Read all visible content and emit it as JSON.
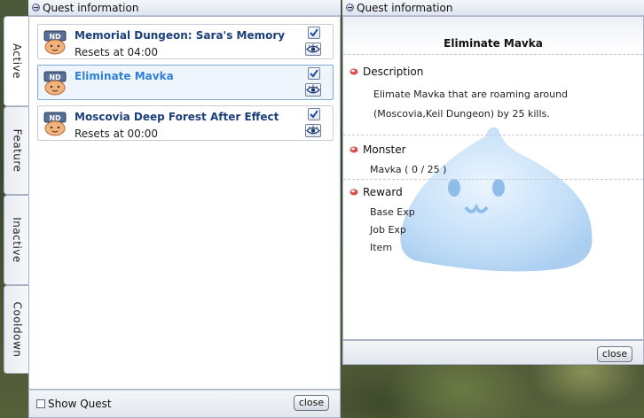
{
  "left_window": {
    "title": "Quest information",
    "tabs": [
      {
        "label": "Active",
        "active": true
      },
      {
        "label": "Feature",
        "active": false
      },
      {
        "label": "Inactive",
        "active": false
      },
      {
        "label": "Cooldown",
        "active": false
      }
    ],
    "quests": [
      {
        "title": "Memorial Dungeon: Sara's Memory",
        "subtitle": "Resets at 04:00",
        "checked": true,
        "selected": false
      },
      {
        "title": "Eliminate Mavka",
        "subtitle": "",
        "checked": true,
        "selected": true
      },
      {
        "title": "Moscovia Deep Forest After Effect",
        "subtitle": "Resets at 00:00",
        "checked": true,
        "selected": false
      }
    ],
    "show_quest_label": "Show Quest",
    "close_label": "close",
    "quest_icon_text": "ND"
  },
  "right_window": {
    "title": "Quest information",
    "quest_title": "Eliminate Mavka",
    "description_heading": "Description",
    "description_lines": [
      "Elimate Mavka that are roaming around",
      "(Moscovia,Keil Dungeon) by 25 kills."
    ],
    "monster_heading": "Monster",
    "monster_line": "Mavka ( 0 / 25 )",
    "reward_heading": "Reward",
    "reward_lines": [
      "Base Exp",
      "Job Exp",
      "Item"
    ],
    "close_label": "close"
  },
  "colors": {
    "quest_title": "#1b3f78",
    "quest_title_selected": "#2f80d6",
    "bullet": "#d9524a",
    "watermark": "#a9cdf2"
  },
  "icons": {
    "check": "check-icon",
    "eye": "eye-icon",
    "bullet": "red-bullet-icon",
    "quest": "quest-face-icon"
  }
}
